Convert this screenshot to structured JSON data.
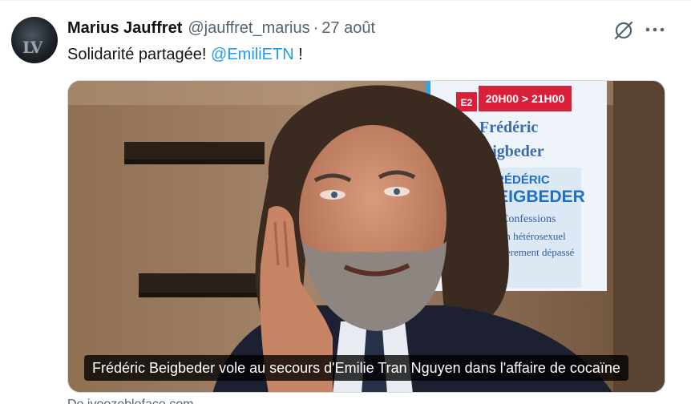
{
  "tweet": {
    "author_name": "Marius Jauffret",
    "handle": "@jauffret_marius",
    "separator": "·",
    "date": "27 août",
    "text_before": "Solidarité partagée! ",
    "mention": "@EmiliETN",
    "text_after": " !",
    "avatar_letters": "LV"
  },
  "card": {
    "poster_channel": "E2",
    "poster_time": "20H00 > 21H00",
    "poster_name_line1": "Frédéric",
    "poster_name_line2": "Beigbeder",
    "poster_book_line1": "FRÉDÉRIC",
    "poster_book_line2": "BEIGBEDER",
    "poster_book_line3": "Confessions",
    "poster_book_line4": "d'un hétérosexuel",
    "poster_book_line5": "légèrement dépassé",
    "caption": "Frédéric Beigbeder vole au secours d'Emilie Tran Nguyen dans l'affaire de cocaïne",
    "source": "De ivoozebleface.com"
  },
  "icons": {
    "grok": "grok-icon",
    "more": "more-icon"
  },
  "colors": {
    "accent": "#1d9bf0",
    "text": "#0f1419",
    "secondary": "#536471",
    "poster_red": "#d8203a"
  }
}
